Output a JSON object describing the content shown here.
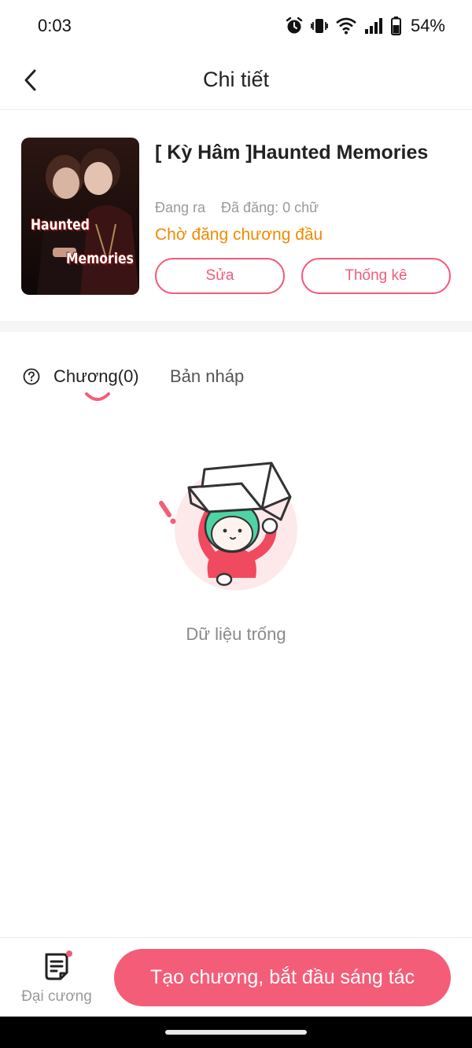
{
  "status_bar": {
    "time": "0:03",
    "battery_percent": "54%",
    "icons": [
      "alarm-icon",
      "vibrate-icon",
      "wifi-icon",
      "signal-icon",
      "battery-icon"
    ]
  },
  "header": {
    "title": "Chi tiết",
    "back_icon": "chevron-left-icon"
  },
  "book": {
    "title": "[ Kỳ Hâm ]Haunted Memories",
    "cover_text_line1": "Haunted",
    "cover_text_line2": "Memories",
    "status": "Đang ra",
    "published": "Đã đăng: 0 chữ",
    "notice": "Chờ đăng chương đầu",
    "edit_label": "Sửa",
    "stats_label": "Thống kê"
  },
  "tabs": {
    "help_icon": "question-circle-icon",
    "items": [
      {
        "label": "Chương(0)",
        "active": true
      },
      {
        "label": "Bản nháp",
        "active": false
      }
    ]
  },
  "empty_state": {
    "text": "Dữ liệu trống"
  },
  "bottom_bar": {
    "outline_label": "Đại cương",
    "create_label": "Tạo chương, bắt đầu sáng tác"
  },
  "colors": {
    "accent": "#f45d78",
    "notice": "#f08a00",
    "muted": "#9a9a9a"
  }
}
